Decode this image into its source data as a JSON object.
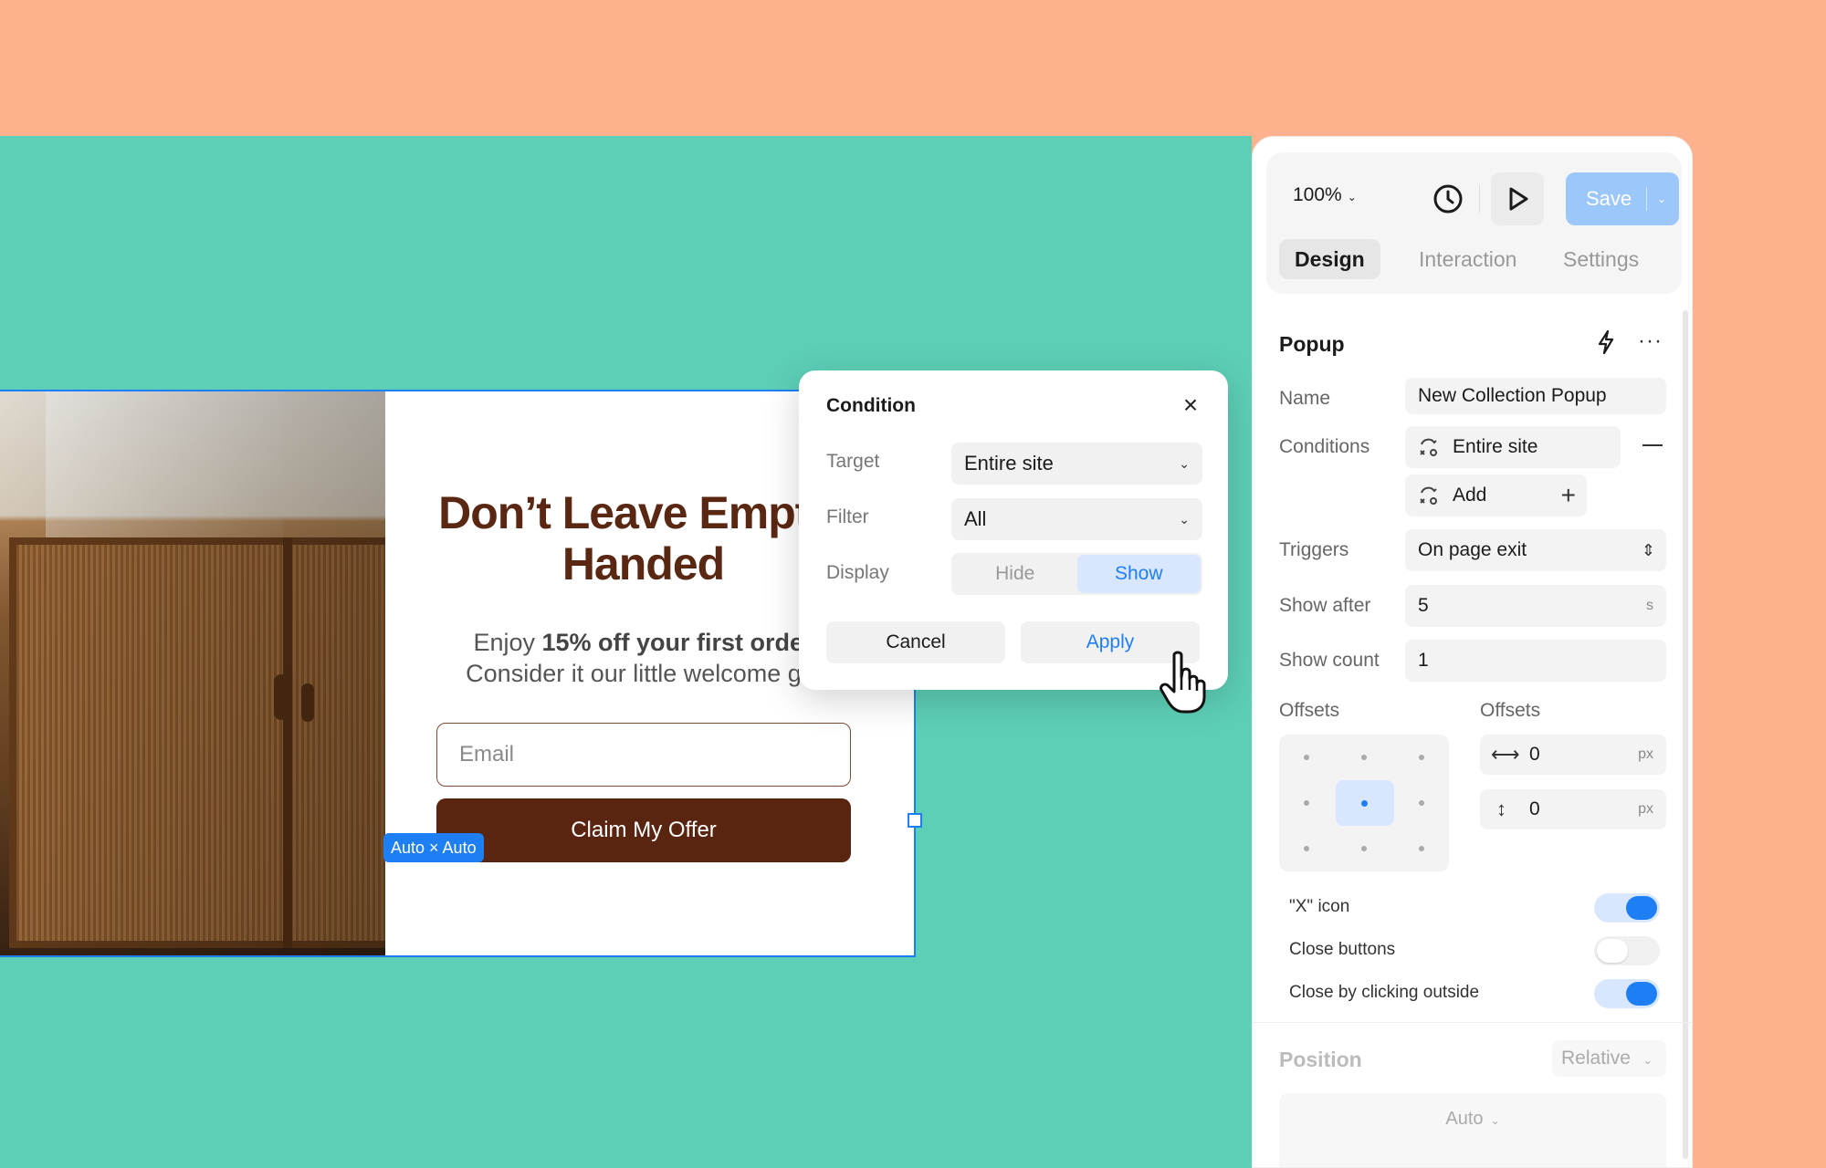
{
  "popup": {
    "title": "Don’t Leave Empty-Handed",
    "subtitle_prefix": "Enjoy ",
    "subtitle_bold": "15% off your first order",
    "subtitle_line2": "Consider it our little welcome gift",
    "email_placeholder": "Email",
    "cta_label": "Claim My Offer",
    "size_badge": "Auto × Auto"
  },
  "condition_dialog": {
    "title": "Condition",
    "target_label": "Target",
    "target_value": "Entire site",
    "filter_label": "Filter",
    "filter_value": "All",
    "display_label": "Display",
    "display_options": [
      "Hide",
      "Show"
    ],
    "display_selected": "Show",
    "cancel_label": "Cancel",
    "apply_label": "Apply"
  },
  "panel": {
    "zoom": "100%",
    "save_label": "Save",
    "tabs": [
      "Design",
      "Interaction",
      "Settings"
    ],
    "active_tab": "Design",
    "section_title": "Popup",
    "name_label": "Name",
    "name_value": "New Collection Popup",
    "conditions_label": "Conditions",
    "condition_item": "Entire site",
    "add_label": "Add",
    "triggers_label": "Triggers",
    "triggers_value": "On page exit",
    "show_after_label": "Show after",
    "show_after_value": "5",
    "show_after_unit": "s",
    "show_count_label": "Show count",
    "show_count_value": "1",
    "offsets_label_left": "Offsets",
    "offsets_label_right": "Offsets",
    "offset_x": "0",
    "offset_y": "0",
    "offset_unit": "px",
    "toggles": [
      {
        "label": "\"X\" icon",
        "on": true
      },
      {
        "label": "Close buttons",
        "on": false
      },
      {
        "label": "Close by clicking outside",
        "on": true
      }
    ],
    "position_title": "Position",
    "position_value": "Relative",
    "position_auto": "Auto"
  },
  "colors": {
    "accent": "#1e7ff5",
    "canvas": "#5dcfb6",
    "background": "#fdb18c",
    "cta": "#5a2510"
  }
}
